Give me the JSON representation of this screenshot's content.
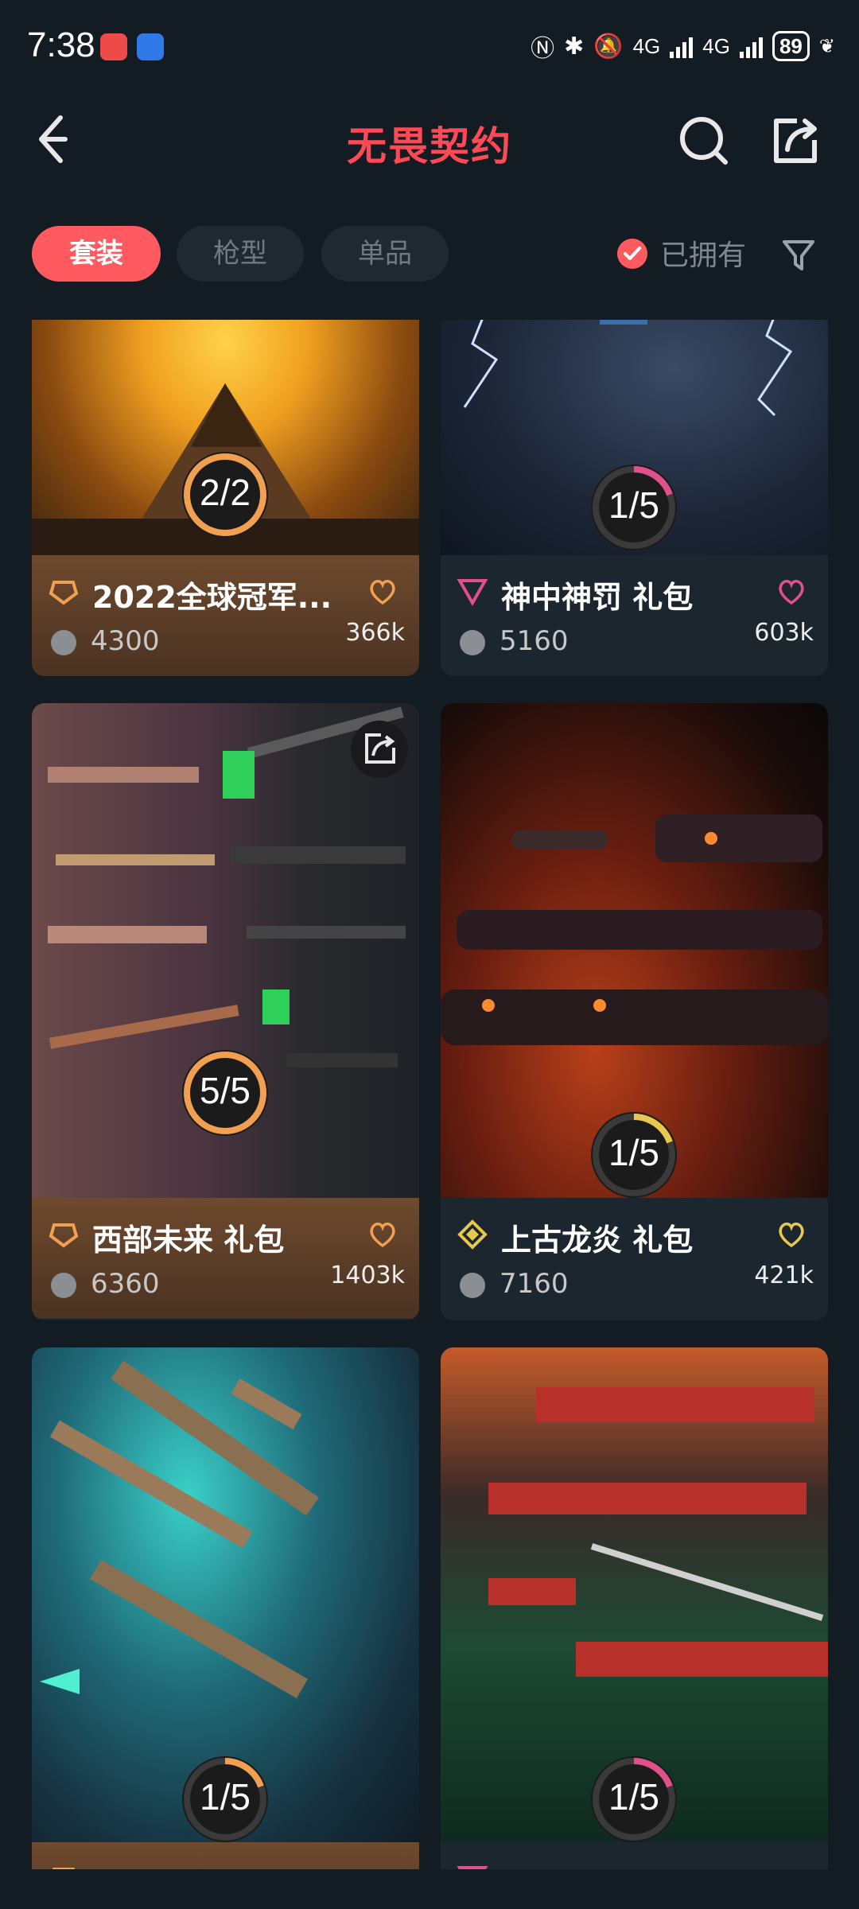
{
  "status_bar": {
    "time": "7:38",
    "network": "4G",
    "battery": "89"
  },
  "header": {
    "title": "无畏契约"
  },
  "filters": {
    "tabs": [
      {
        "label": "套装",
        "active": true
      },
      {
        "label": "枪型",
        "active": false
      },
      {
        "label": "单品",
        "active": false
      }
    ],
    "owned_label": "已拥有"
  },
  "bundles": [
    {
      "title": "2022全球冠军...",
      "price": "4300",
      "likes": "366k",
      "progress": "2/2",
      "rarity": "orange",
      "accent": "#f0a050"
    },
    {
      "title": "神中神罚 礼包",
      "price": "5160",
      "likes": "603k",
      "progress": "1/5",
      "rarity": "pink",
      "accent": "#e0508a"
    },
    {
      "title": "西部未来 礼包",
      "price": "6360",
      "likes": "1403k",
      "progress": "5/5",
      "rarity": "orange",
      "accent": "#f0a050"
    },
    {
      "title": "上古龙炎 礼包",
      "price": "7160",
      "likes": "421k",
      "progress": "1/5",
      "rarity": "yellow",
      "accent": "#e8c850"
    },
    {
      "title": "",
      "price": "",
      "likes": "",
      "progress": "1/5",
      "rarity": "orange",
      "accent": "#f0a050"
    },
    {
      "title": "",
      "price": "",
      "likes": "",
      "progress": "1/5",
      "rarity": "pink",
      "accent": "#e0508a"
    }
  ]
}
